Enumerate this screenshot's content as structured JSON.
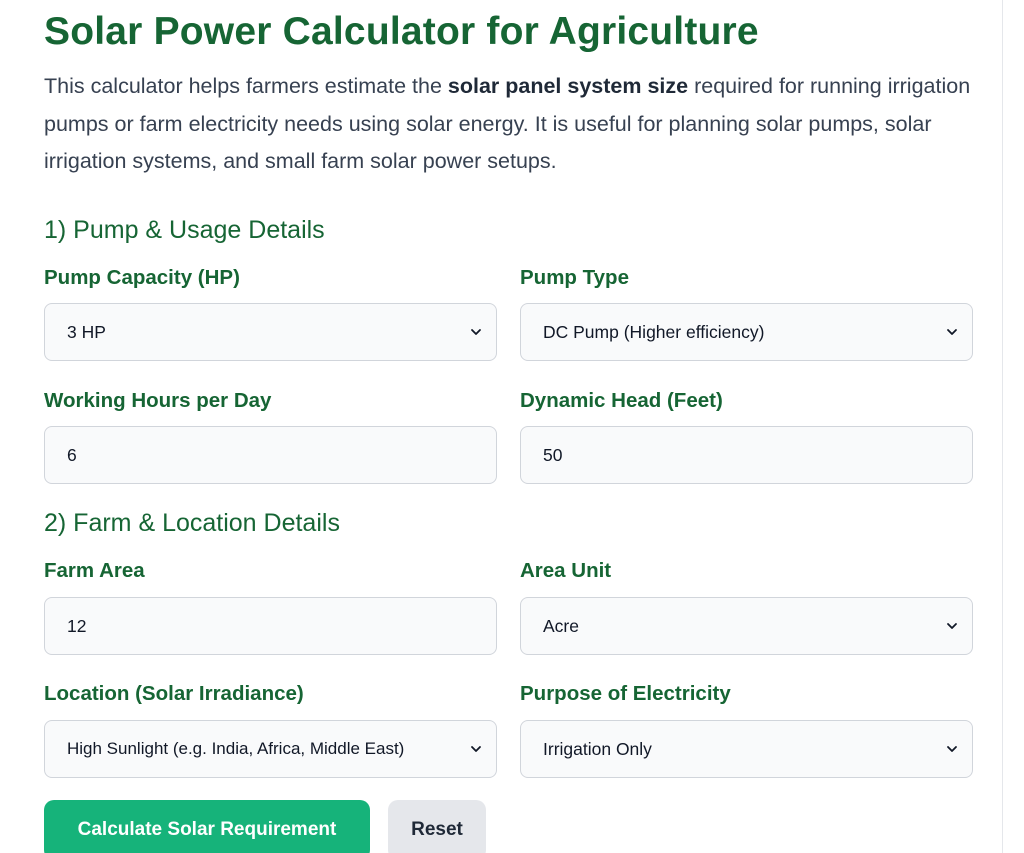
{
  "page": {
    "title": "Solar Power Calculator for Agriculture",
    "intro": {
      "before": "This calculator helps farmers estimate the ",
      "bold": "solar panel system size",
      "after": " required for running irrigation pumps or farm electricity needs using solar energy. It is useful for planning solar pumps, solar irrigation systems, and small farm solar power setups."
    }
  },
  "sections": {
    "pump": {
      "heading": "1) Pump & Usage Details",
      "pump_capacity": {
        "label": "Pump Capacity (HP)",
        "selected": "3 HP"
      },
      "pump_type": {
        "label": "Pump Type",
        "selected": "DC Pump (Higher efficiency)"
      },
      "working_hours": {
        "label": "Working Hours per Day",
        "value": "6"
      },
      "dynamic_head": {
        "label": "Dynamic Head (Feet)",
        "value": "50"
      }
    },
    "farm": {
      "heading": "2) Farm & Location Details",
      "farm_area": {
        "label": "Farm Area",
        "value": "12"
      },
      "area_unit": {
        "label": "Area Unit",
        "selected": "Acre"
      },
      "location": {
        "label": "Location (Solar Irradiance)",
        "selected": "High Sunlight (e.g. India, Africa, Middle East)"
      },
      "purpose": {
        "label": "Purpose of Electricity",
        "selected": "Irrigation Only"
      }
    }
  },
  "actions": {
    "calculate_label": "Calculate Solar Requirement",
    "reset_label": "Reset"
  },
  "colors": {
    "heading_green": "#166534",
    "primary_button": "#16b37a",
    "secondary_button": "#e5e7eb"
  }
}
